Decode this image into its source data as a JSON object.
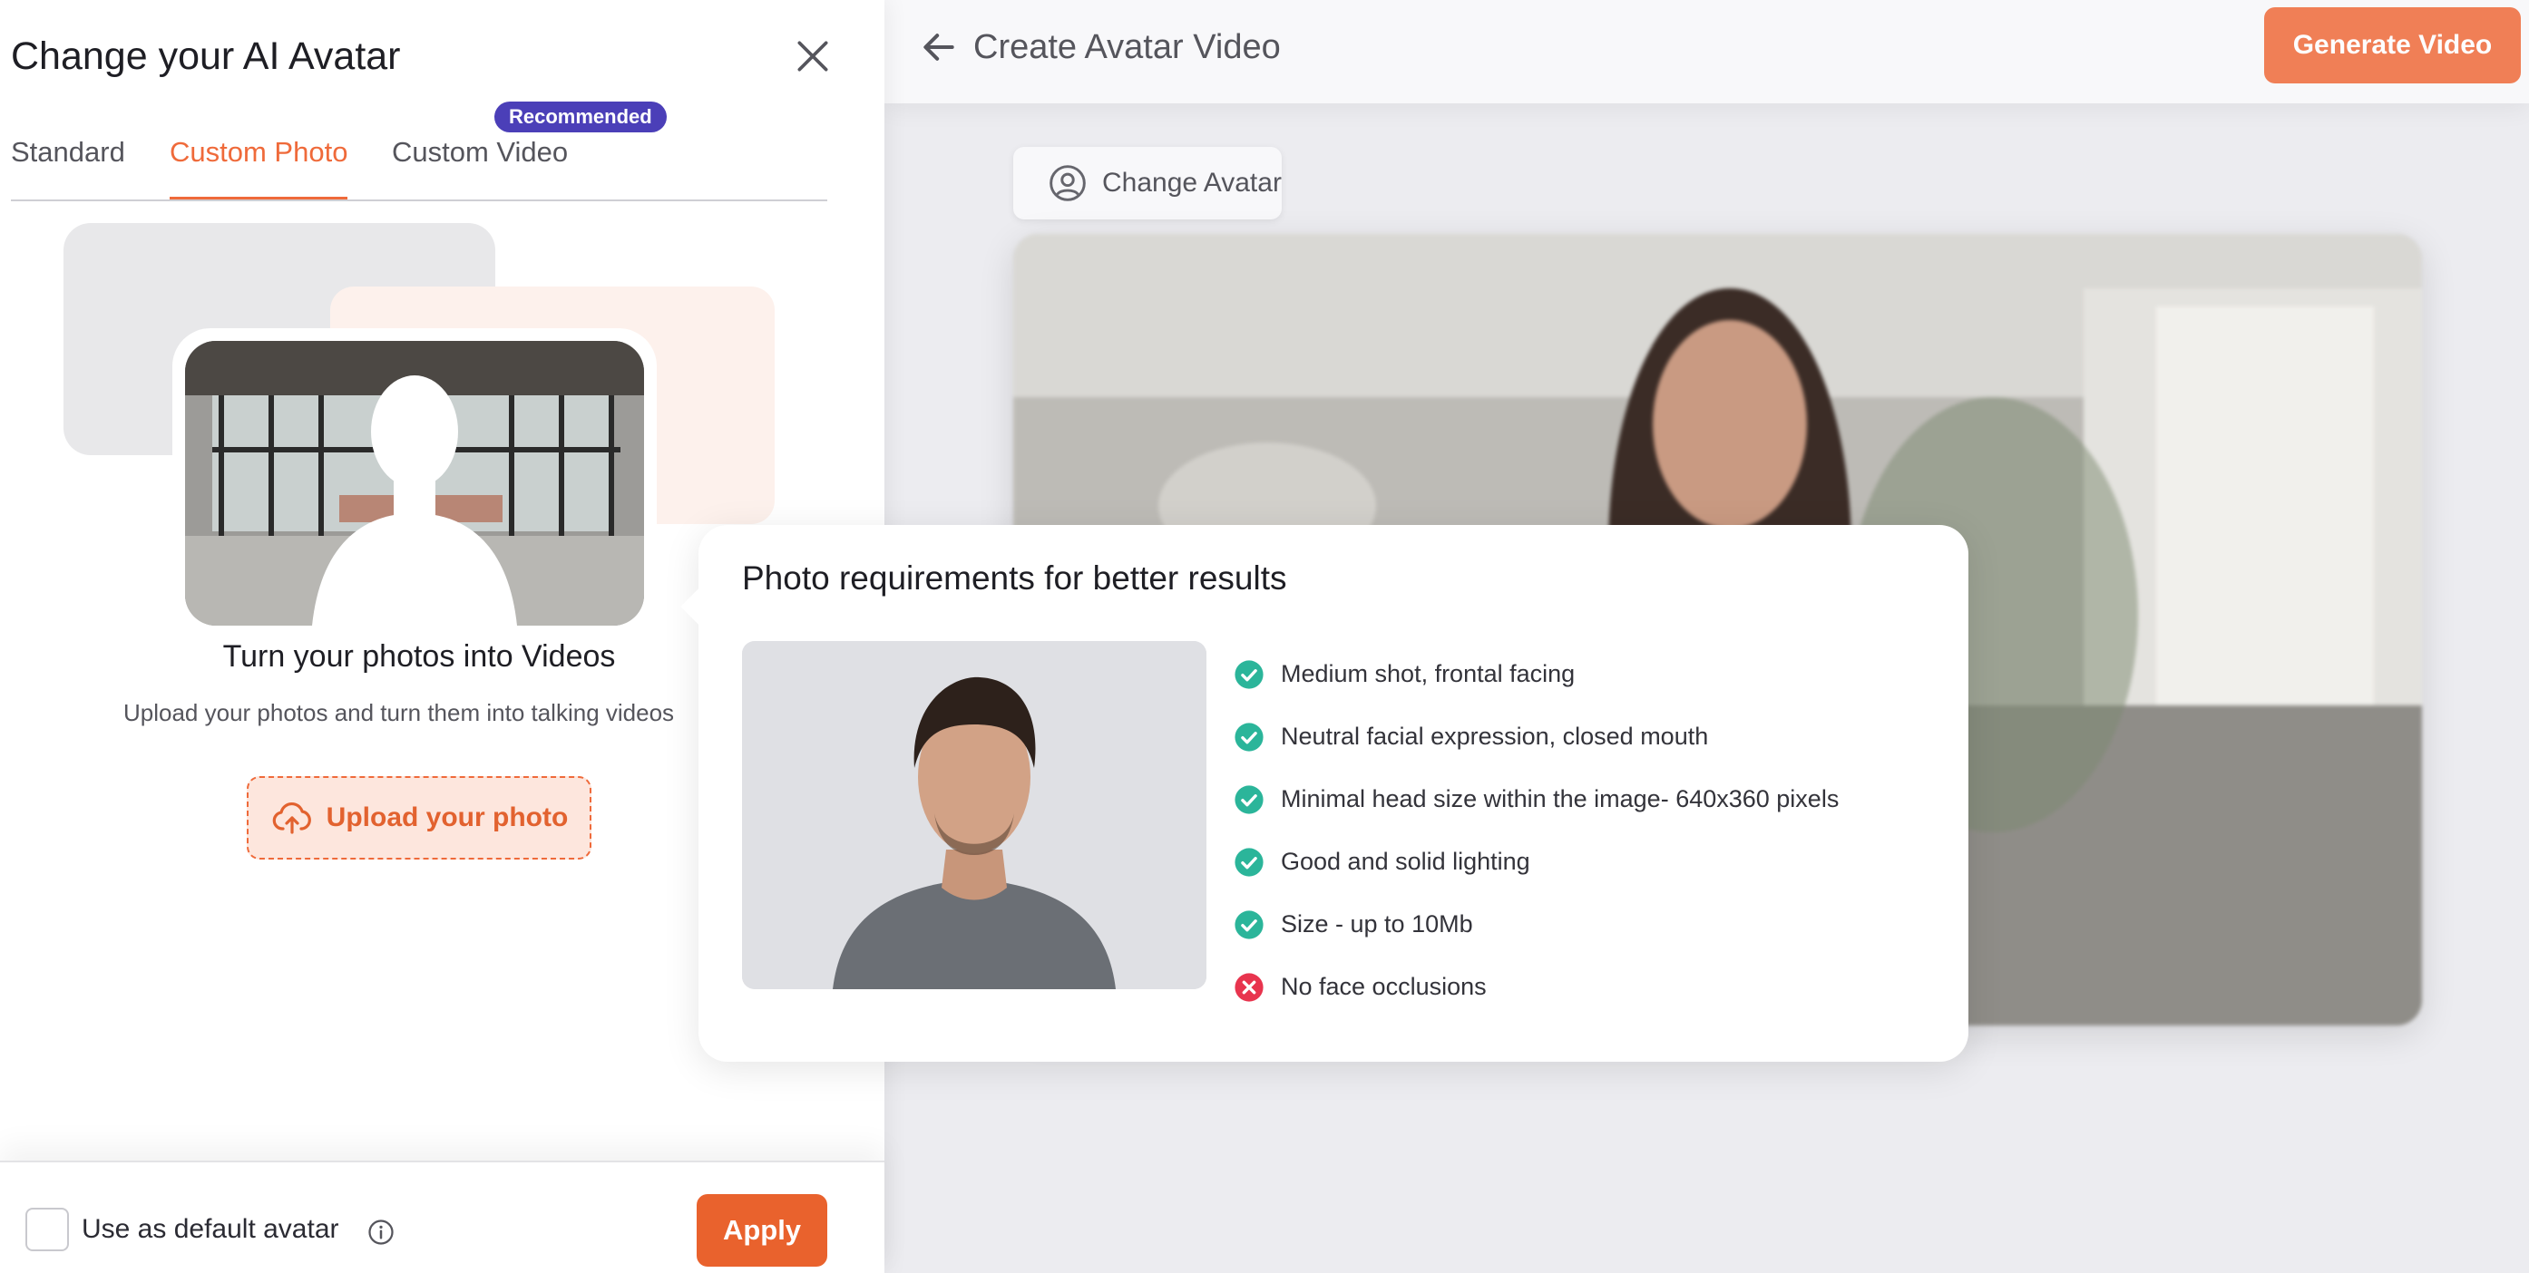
{
  "editor": {
    "title": "Create Avatar Video",
    "generate_label": "Generate Video",
    "change_avatar_label": "Change Avatar"
  },
  "panel": {
    "title": "Change your AI Avatar",
    "tabs": [
      {
        "label": "Standard",
        "active": false
      },
      {
        "label": "Custom Photo",
        "active": true
      },
      {
        "label": "Custom Video",
        "active": false
      }
    ],
    "badge": "Recommended",
    "heading": "Turn your photos into Videos",
    "subtitle": "Upload your photos and turn them into talking videos",
    "upload_label": "Upload your photo",
    "footer": {
      "default_label": "Use as default avatar",
      "apply_label": "Apply"
    }
  },
  "popover": {
    "title": "Photo requirements for better results",
    "requirements": [
      {
        "text": "Medium shot, frontal facing",
        "ok": true
      },
      {
        "text": "Neutral facial expression, closed mouth",
        "ok": true
      },
      {
        "text": "Minimal head size within the image- 640x360 pixels",
        "ok": true
      },
      {
        "text": "Good and solid lighting",
        "ok": true
      },
      {
        "text": "Size - up to 10Mb",
        "ok": true
      },
      {
        "text": "No face occlusions",
        "ok": false
      }
    ]
  },
  "colors": {
    "accent": "#ef6a3a",
    "badge": "#4b3fb8",
    "ok": "#2bb59a",
    "bad": "#e8344e"
  }
}
